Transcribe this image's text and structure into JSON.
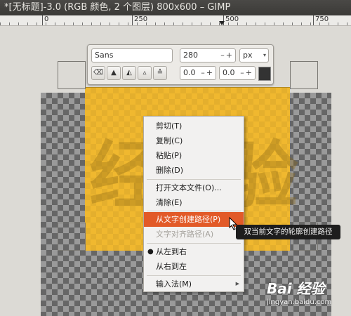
{
  "window": {
    "title": "*[无标题]-3.0 (RGB 颜色, 2 个图层) 800x600 – GIMP"
  },
  "ruler": {
    "labels": [
      "0",
      "250",
      "500",
      "750"
    ]
  },
  "text_toolbox": {
    "font": "Sans",
    "size": "280",
    "unit": "px",
    "indent": "0.0",
    "line_spacing": "0.0",
    "color": "#333333"
  },
  "layer_text": "经验",
  "context_menu": {
    "items": [
      "剪切(T)",
      "复制(C)",
      "粘贴(P)",
      "删除(D)",
      "打开文本文件(O)...",
      "清除(E)",
      "从文字创建路径(P)",
      "文字对齐路径(A)",
      "从左到右",
      "从右到左",
      "输入法(M)"
    ]
  },
  "tooltip": "双当前文字的轮廓创建路径",
  "watermark": {
    "logo": "Bai 经验",
    "url": "jingyan.baidu.com"
  },
  "colors": {
    "layer_fill": "#f0b82f",
    "menu_highlight": "#e25a28"
  }
}
